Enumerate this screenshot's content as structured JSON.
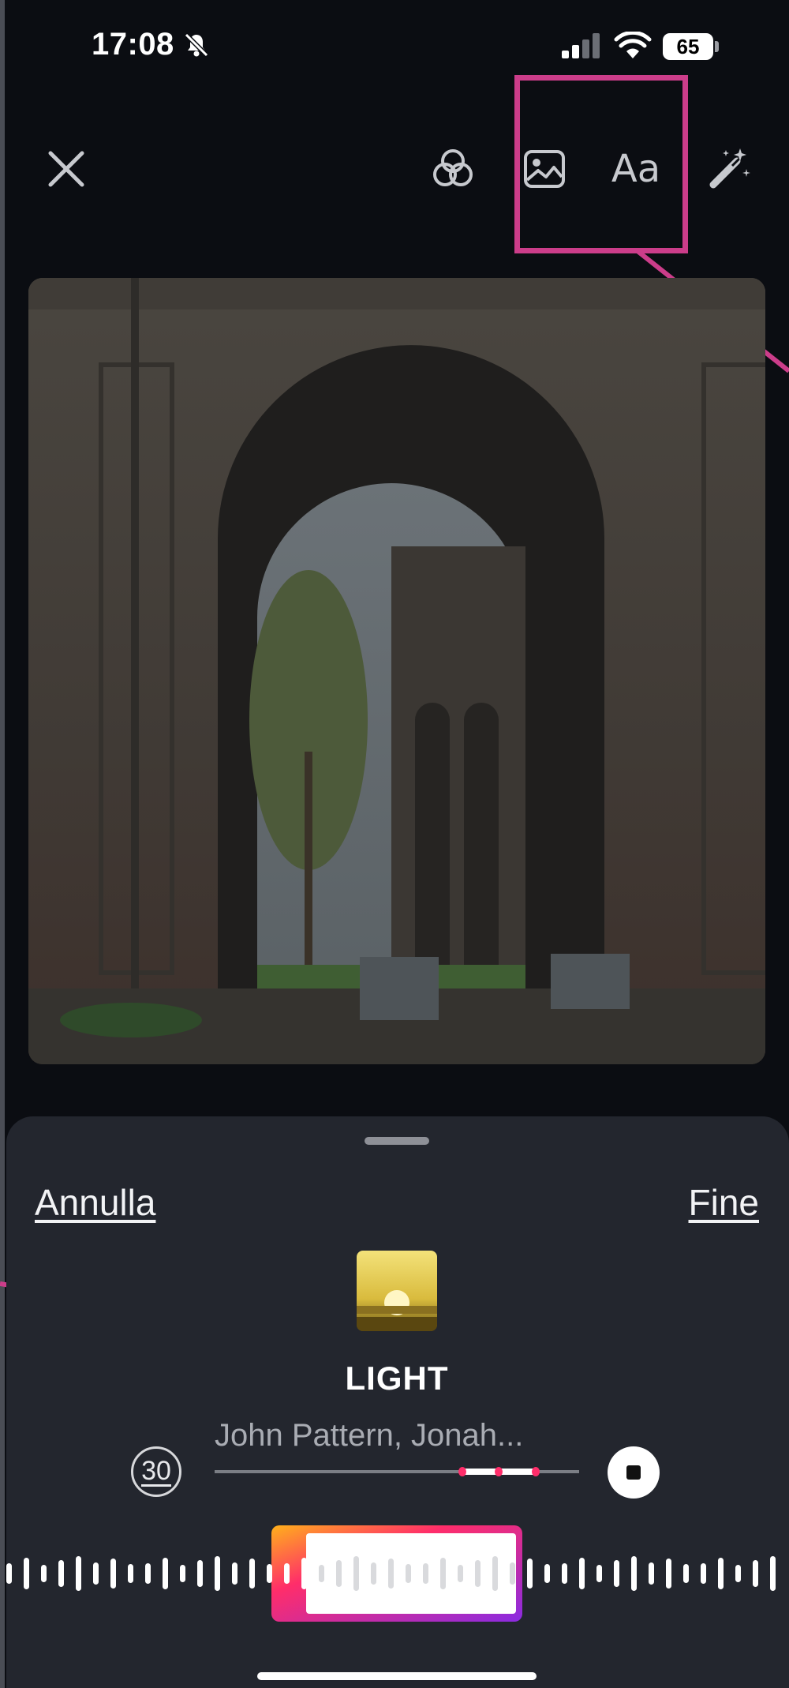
{
  "status_bar": {
    "time": "17:08",
    "battery": "65",
    "icons": [
      "bell-slash-icon",
      "signal-icon",
      "wifi-icon",
      "battery-icon"
    ]
  },
  "toolbar": {
    "text_label": "Aa",
    "icons": [
      "close-icon",
      "filters-icon",
      "image-icon",
      "text-icon",
      "magic-wand-icon"
    ]
  },
  "sheet": {
    "cancel_label": "Annulla",
    "done_label": "Fine"
  },
  "music": {
    "title": "LIGHT",
    "artist": "John Pattern, Jonah...",
    "duration_badge": "30",
    "selection_start": 0.68,
    "selection_end": 0.88
  },
  "colors": {
    "background": "#0b0d12",
    "sheet": "#23262e",
    "highlight_annotation": "#cc3d8a",
    "progress_accent": "#ff2d6a",
    "selection_gradient_start": "#ff9f1a",
    "selection_gradient_end": "#8a2be2"
  }
}
